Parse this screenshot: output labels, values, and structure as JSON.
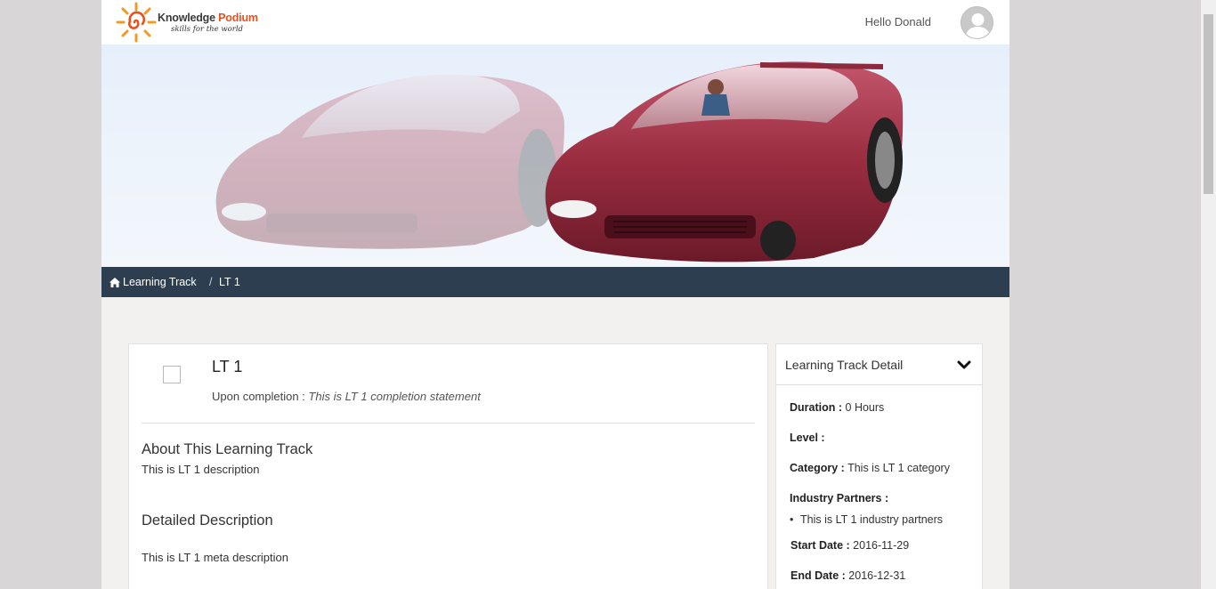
{
  "brand": {
    "name_part1": "Knowledge ",
    "name_part2": "Podium",
    "tagline": "skills for the world",
    "accent_color": "#e8501d"
  },
  "header": {
    "greeting": "Hello Donald"
  },
  "breadcrumb": {
    "home_label": "Learning Track",
    "separator": "/",
    "current": "LT 1",
    "bar_color": "#2d3e50"
  },
  "track": {
    "title": "LT 1",
    "completion_label": "Upon completion : ",
    "completion_statement": "This is LT 1 completion statement",
    "about_heading": "About This Learning Track",
    "about_text": "This is LT 1 description",
    "detail_heading": "Detailed Description",
    "detail_text": "This is LT 1 meta description"
  },
  "detail_panel": {
    "title": "Learning Track Detail",
    "toggle_icon": "chevron-down-icon",
    "duration_label": "Duration :",
    "duration_value": "0 Hours",
    "level_label": "Level :",
    "level_value": "",
    "category_label": "Category :",
    "category_value": "This is LT 1 category",
    "partners_label": "Industry Partners :",
    "partners": [
      "This is LT 1 industry partners"
    ],
    "start_label": "Start Date :",
    "start_value": "2016-11-29",
    "end_label": "End Date :",
    "end_value": "2016-12-31"
  },
  "icons": {
    "home": "home-icon",
    "avatar": "user-avatar-icon",
    "logo": "sun-logo-icon"
  }
}
